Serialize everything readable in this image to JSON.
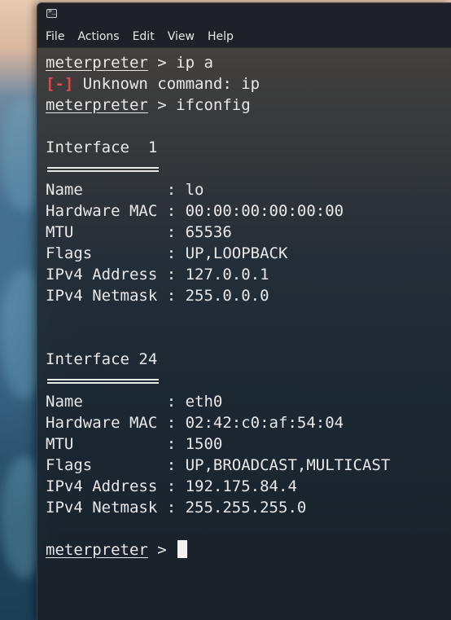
{
  "window": {
    "icon": "terminal-icon",
    "icon_glyph": ">_"
  },
  "menu": {
    "items": [
      "File",
      "Actions",
      "Edit",
      "View",
      "Help"
    ]
  },
  "terminal": {
    "prompt": "meterpreter",
    "prompt_suffix": " > ",
    "cmd1": "ip a",
    "error_tag": "[-]",
    "error_msg": " Unknown command: ip",
    "cmd2": "ifconfig",
    "interfaces": [
      {
        "header": "Interface  1",
        "rows": [
          {
            "key": "Name         ",
            "value": "lo"
          },
          {
            "key": "Hardware MAC ",
            "value": "00:00:00:00:00:00"
          },
          {
            "key": "MTU          ",
            "value": "65536"
          },
          {
            "key": "Flags        ",
            "value": "UP,LOOPBACK"
          },
          {
            "key": "IPv4 Address ",
            "value": "127.0.0.1"
          },
          {
            "key": "IPv4 Netmask ",
            "value": "255.0.0.0"
          }
        ]
      },
      {
        "header": "Interface 24",
        "rows": [
          {
            "key": "Name         ",
            "value": "eth0"
          },
          {
            "key": "Hardware MAC ",
            "value": "02:42:c0:af:54:04"
          },
          {
            "key": "MTU          ",
            "value": "1500"
          },
          {
            "key": "Flags        ",
            "value": "UP,BROADCAST,MULTICAST"
          },
          {
            "key": "IPv4 Address ",
            "value": "192.175.84.4"
          },
          {
            "key": "IPv4 Netmask ",
            "value": "255.255.255.0"
          }
        ]
      }
    ],
    "separator": ": "
  },
  "colors": {
    "text": "#e8e8e8",
    "error": "#e0484f",
    "menubar": "#1e2127"
  }
}
